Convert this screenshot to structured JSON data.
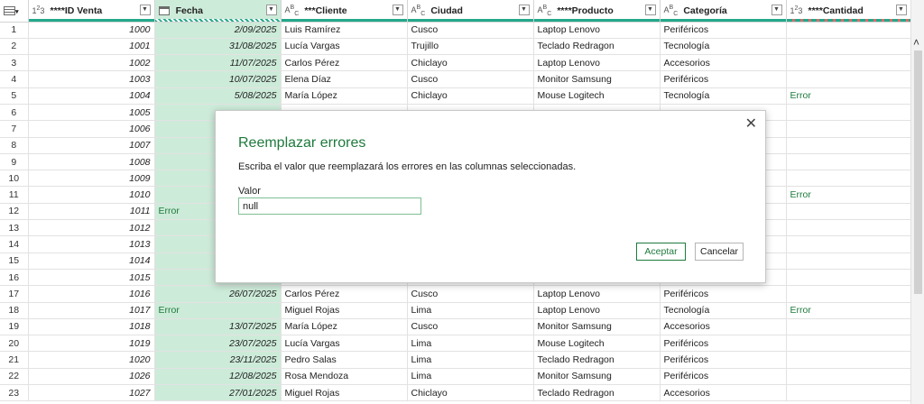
{
  "columns": [
    {
      "type_icon": "1 2 3",
      "label": "****ID Venta"
    },
    {
      "type_icon": "calendar-icon",
      "label": "Fecha"
    },
    {
      "type_icon": "A B C",
      "label": "***Cliente"
    },
    {
      "type_icon": "A B C",
      "label": "Ciudad"
    },
    {
      "type_icon": "A B C",
      "label": "****Producto"
    },
    {
      "type_icon": "A B C",
      "label": "Categoría"
    },
    {
      "type_icon": "1 2 3",
      "label": "****Cantidad"
    }
  ],
  "rows": [
    {
      "n": "1",
      "id": "1000",
      "fecha": "2/09/2025",
      "cliente": "Luis Ramírez",
      "ciudad": "Cusco",
      "producto": "Laptop Lenovo",
      "categoria": "Periféricos",
      "cantidad": ""
    },
    {
      "n": "2",
      "id": "1001",
      "fecha": "31/08/2025",
      "cliente": "Lucía Vargas",
      "ciudad": "Trujillo",
      "producto": "Teclado Redragon",
      "categoria": "Tecnología",
      "cantidad": ""
    },
    {
      "n": "3",
      "id": "1002",
      "fecha": "11/07/2025",
      "cliente": "Carlos Pérez",
      "ciudad": "Chiclayo",
      "producto": "Laptop Lenovo",
      "categoria": "Accesorios",
      "cantidad": ""
    },
    {
      "n": "4",
      "id": "1003",
      "fecha": "10/07/2025",
      "cliente": "Elena Díaz",
      "ciudad": "Cusco",
      "producto": "Monitor Samsung",
      "categoria": "Periféricos",
      "cantidad": ""
    },
    {
      "n": "5",
      "id": "1004",
      "fecha": "5/08/2025",
      "cliente": "María López",
      "ciudad": "Chiclayo",
      "producto": "Mouse Logitech",
      "categoria": "Tecnología",
      "cantidad": "Error"
    },
    {
      "n": "6",
      "id": "1005",
      "fecha": "",
      "cliente": "",
      "ciudad": "",
      "producto": "",
      "categoria": "",
      "cantidad": ""
    },
    {
      "n": "7",
      "id": "1006",
      "fecha": "",
      "cliente": "",
      "ciudad": "",
      "producto": "",
      "categoria": "",
      "cantidad": ""
    },
    {
      "n": "8",
      "id": "1007",
      "fecha": "",
      "cliente": "",
      "ciudad": "",
      "producto": "",
      "categoria": "",
      "cantidad": ""
    },
    {
      "n": "9",
      "id": "1008",
      "fecha": "",
      "cliente": "",
      "ciudad": "",
      "producto": "",
      "categoria": "",
      "cantidad": ""
    },
    {
      "n": "10",
      "id": "1009",
      "fecha": "",
      "cliente": "",
      "ciudad": "",
      "producto": "",
      "categoria": "",
      "cantidad": ""
    },
    {
      "n": "11",
      "id": "1010",
      "fecha": "",
      "cliente": "",
      "ciudad": "",
      "producto": "",
      "categoria": "",
      "cantidad": "Error"
    },
    {
      "n": "12",
      "id": "1011",
      "fecha": "Error",
      "cliente": "",
      "ciudad": "",
      "producto": "",
      "categoria": "",
      "cantidad": ""
    },
    {
      "n": "13",
      "id": "1012",
      "fecha": "",
      "cliente": "",
      "ciudad": "",
      "producto": "",
      "categoria": "",
      "cantidad": ""
    },
    {
      "n": "14",
      "id": "1013",
      "fecha": "",
      "cliente": "",
      "ciudad": "",
      "producto": "",
      "categoria": "",
      "cantidad": ""
    },
    {
      "n": "15",
      "id": "1014",
      "fecha": "",
      "cliente": "",
      "ciudad": "",
      "producto": "",
      "categoria": "",
      "cantidad": ""
    },
    {
      "n": "16",
      "id": "1015",
      "fecha": "",
      "cliente": "",
      "ciudad": "",
      "producto": "",
      "categoria": "",
      "cantidad": ""
    },
    {
      "n": "17",
      "id": "1016",
      "fecha": "26/07/2025",
      "cliente": "Carlos Pérez",
      "ciudad": "Cusco",
      "producto": "Laptop Lenovo",
      "categoria": "Periféricos",
      "cantidad": ""
    },
    {
      "n": "18",
      "id": "1017",
      "fecha": "Error",
      "cliente": "Miguel Rojas",
      "ciudad": "Lima",
      "producto": "Laptop Lenovo",
      "categoria": "Tecnología",
      "cantidad": "Error"
    },
    {
      "n": "19",
      "id": "1018",
      "fecha": "13/07/2025",
      "cliente": "María López",
      "ciudad": "Cusco",
      "producto": "Monitor Samsung",
      "categoria": "Accesorios",
      "cantidad": ""
    },
    {
      "n": "20",
      "id": "1019",
      "fecha": "23/07/2025",
      "cliente": "Lucía Vargas",
      "ciudad": "Lima",
      "producto": "Mouse Logitech",
      "categoria": "Periféricos",
      "cantidad": ""
    },
    {
      "n": "21",
      "id": "1020",
      "fecha": "23/11/2025",
      "cliente": "Pedro Salas",
      "ciudad": "Lima",
      "producto": "Teclado Redragon",
      "categoria": "Periféricos",
      "cantidad": ""
    },
    {
      "n": "22",
      "id": "1026",
      "fecha": "12/08/2025",
      "cliente": "Rosa Mendoza",
      "ciudad": "Lima",
      "producto": "Monitor Samsung",
      "categoria": "Periféricos",
      "cantidad": ""
    },
    {
      "n": "23",
      "id": "1027",
      "fecha": "27/01/2025",
      "cliente": "Miguel Rojas",
      "ciudad": "Chiclayo",
      "producto": "Teclado Redragon",
      "categoria": "Accesorios",
      "cantidad": ""
    }
  ],
  "dialog": {
    "title": "Reemplazar errores",
    "description": "Escriba el valor que reemplazará los errores en las columnas seleccionadas.",
    "field_label": "Valor",
    "field_value": "null",
    "ok_label": "Aceptar",
    "cancel_label": "Cancelar"
  },
  "colors": {
    "accent": "#1e7a3c",
    "selected_column": "#cdebd9",
    "header_bar": "#23a88a"
  }
}
